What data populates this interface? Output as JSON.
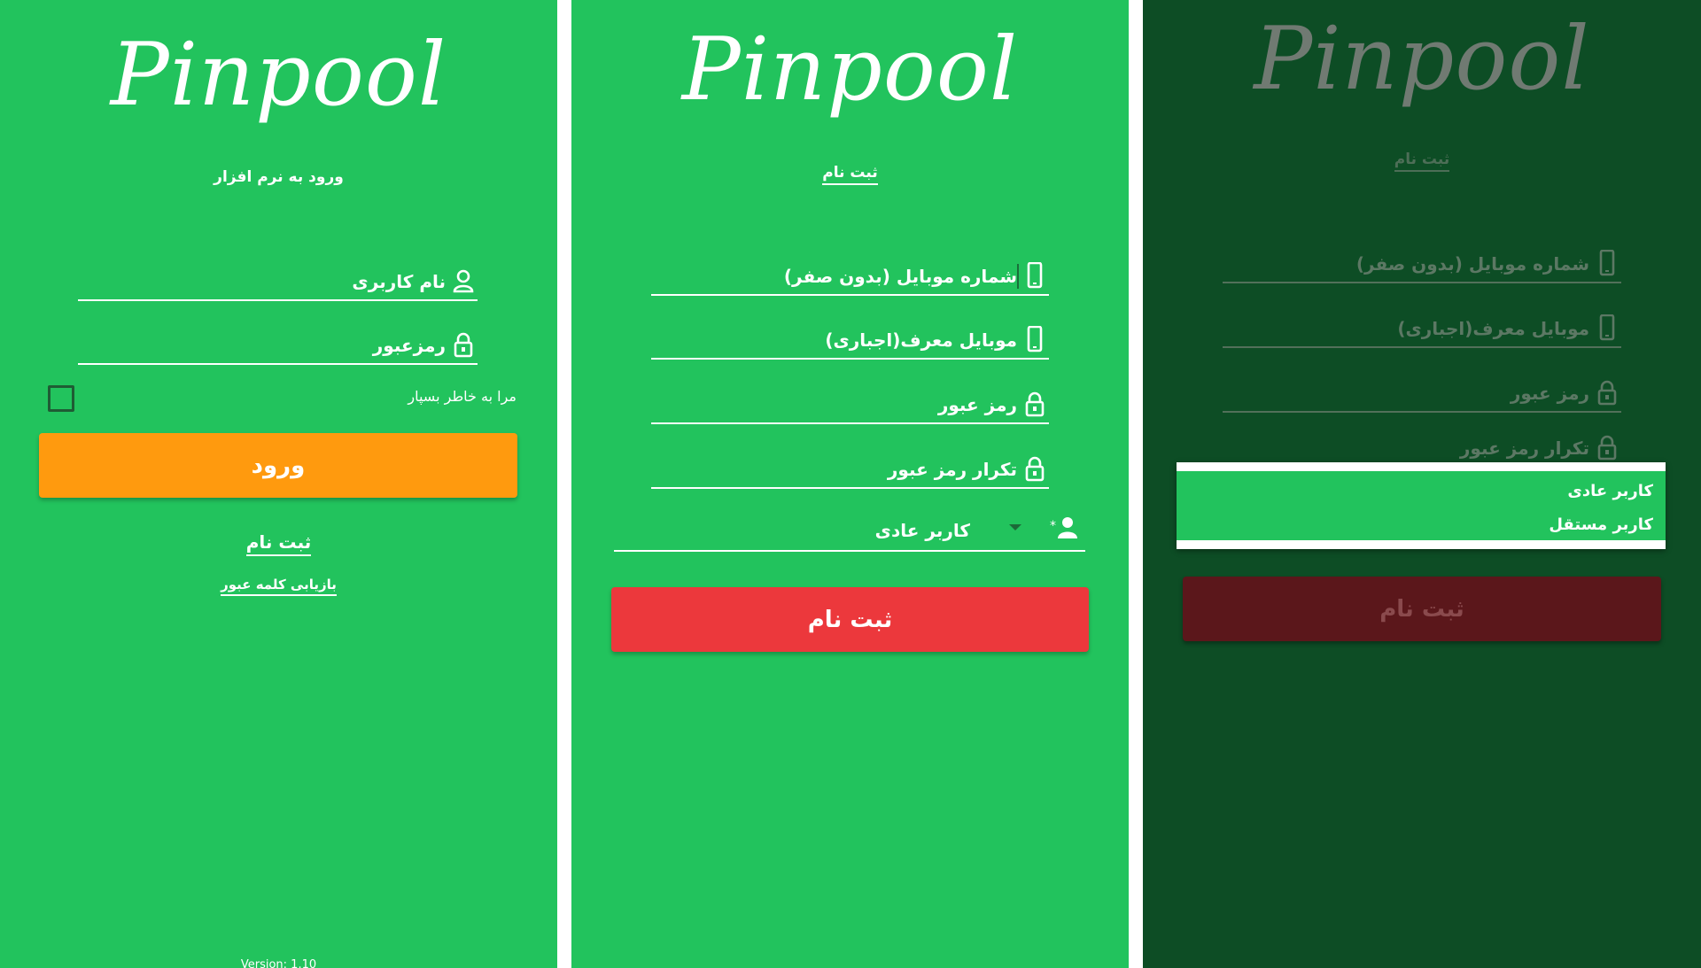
{
  "app": {
    "logo": "Pinpool"
  },
  "colors": {
    "green": "#22c35d",
    "dark_green": "#0d4d25",
    "orange": "#ff9a0e",
    "red": "#ec383c",
    "dark_red": "#5b171b"
  },
  "login": {
    "subtitle": "ورود به نرم افزار",
    "username_placeholder": "نام کاربری",
    "password_placeholder": "رمزعبور",
    "remember_label": "مرا به خاطر بسپار",
    "login_button": "ورود",
    "register_link": "ثبت نام",
    "recover_link": "بازیابی کلمه عبور",
    "version": "Version: 1.10"
  },
  "register": {
    "subtitle": "ثبت نام",
    "mobile_placeholder": "شماره موبایل (بدون صفر)",
    "referrer_placeholder": "موبایل معرف(اجباری)",
    "password_placeholder": "رمز عبور",
    "password_repeat_placeholder": "تکرار رمز عبور",
    "user_type_selected": "کاربر عادی",
    "register_button": "ثبت نام"
  },
  "register_dropdown": {
    "subtitle": "ثبت نام",
    "mobile_placeholder": "شماره موبایل (بدون صفر)",
    "referrer_placeholder": "موبایل معرف(اجباری)",
    "password_placeholder": "رمز عبور",
    "password_repeat_placeholder": "تکرار رمز عبور",
    "options": [
      "کاربر عادی",
      "کاربر مستقل"
    ],
    "register_button": "ثبت نام"
  },
  "icons": {
    "user": "user-icon",
    "lock": "lock-icon",
    "mobile": "mobile-icon",
    "user_type": "add-user-icon",
    "dropdown": "chevron-down-icon"
  }
}
